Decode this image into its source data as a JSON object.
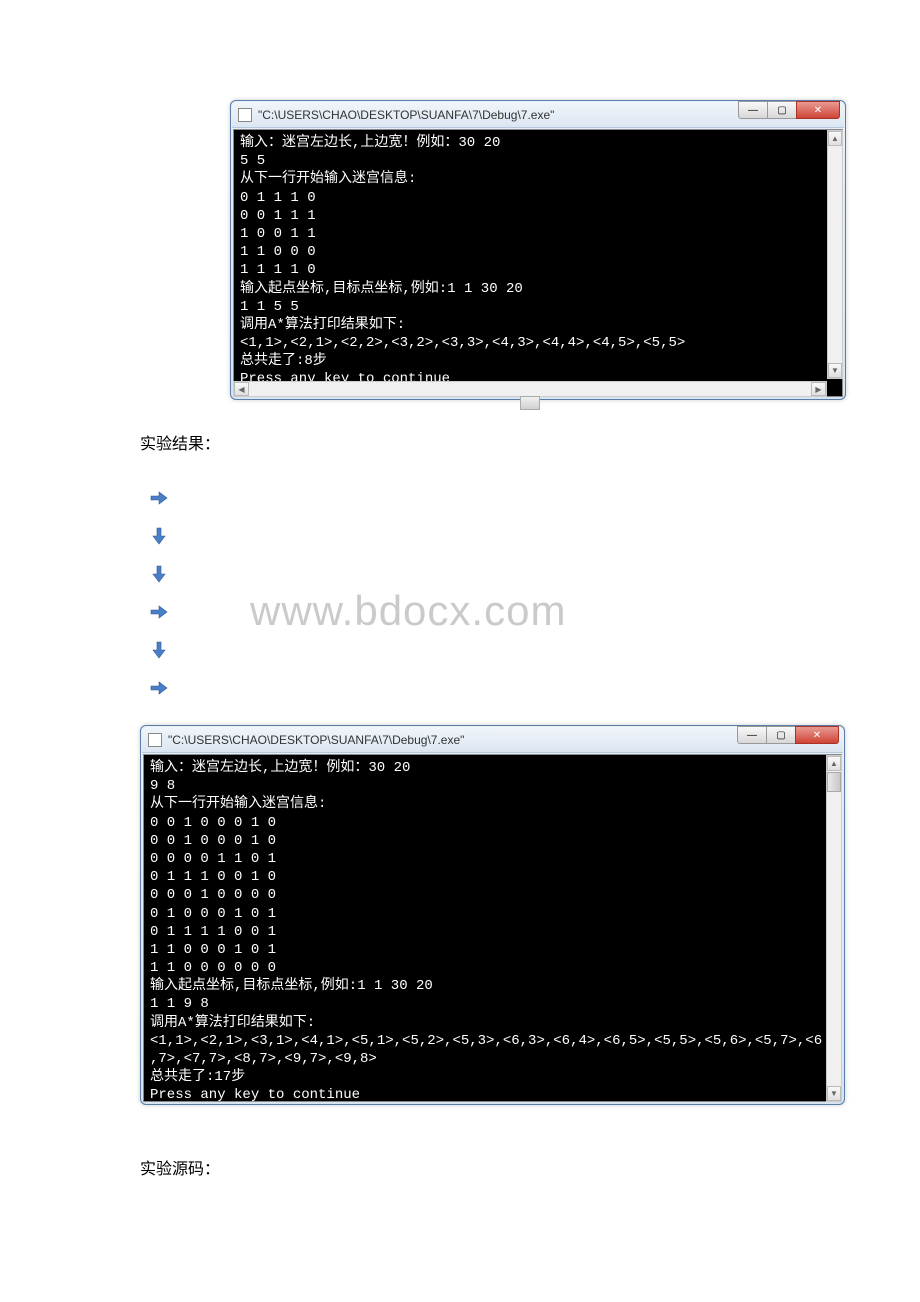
{
  "window1": {
    "title": "\"C:\\USERS\\CHAO\\DESKTOP\\SUANFA\\7\\Debug\\7.exe\"",
    "lines": [
      "输入：迷宫左边长,上边宽！例如：30 20",
      "5 5",
      "从下一行开始输入迷宫信息:",
      "0 1 1 1 0",
      "0 0 1 1 1",
      "1 0 0 1 1",
      "1 1 0 0 0",
      "1 1 1 1 0",
      "输入起点坐标,目标点坐标,例如:1 1 30 20",
      "1 1 5 5",
      "调用A*算法打印结果如下:",
      "<1,1>,<2,1>,<2,2>,<3,2>,<3,3>,<4,3>,<4,4>,<4,5>,<5,5>",
      "总共走了:8步",
      "Press any key to continue"
    ]
  },
  "label1": "实验结果：",
  "watermark": "www.bdocx.com",
  "window2": {
    "title": "\"C:\\USERS\\CHAO\\DESKTOP\\SUANFA\\7\\Debug\\7.exe\"",
    "lines": [
      "输入：迷宫左边长,上边宽！例如：30 20",
      "9 8",
      "从下一行开始输入迷宫信息:",
      "0 0 1 0 0 0 1 0",
      "0 0 1 0 0 0 1 0",
      "0 0 0 0 1 1 0 1",
      "0 1 1 1 0 0 1 0",
      "0 0 0 1 0 0 0 0",
      "0 1 0 0 0 1 0 1",
      "0 1 1 1 1 0 0 1",
      "1 1 0 0 0 1 0 1",
      "1 1 0 0 0 0 0 0",
      "输入起点坐标,目标点坐标,例如:1 1 30 20",
      "1 1 9 8",
      "调用A*算法打印结果如下:",
      "<1,1>,<2,1>,<3,1>,<4,1>,<5,1>,<5,2>,<5,3>,<6,3>,<6,4>,<6,5>,<5,5>,<5,6>,<5,7>,<6",
      ",7>,<7,7>,<8,7>,<9,7>,<9,8>",
      "总共走了:17步",
      "Press any key to continue"
    ]
  },
  "label2": "实验源码："
}
